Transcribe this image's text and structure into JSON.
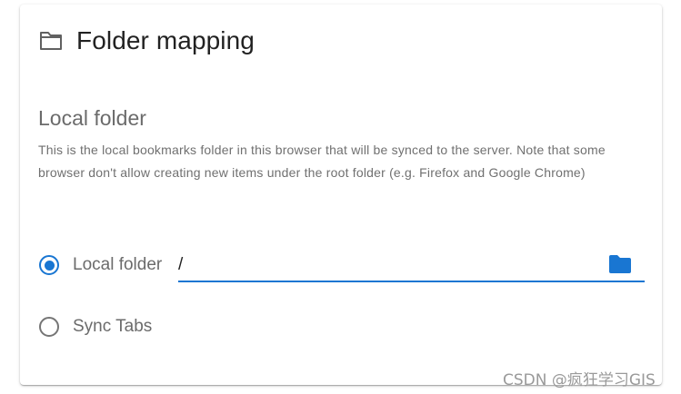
{
  "card": {
    "title": "Folder mapping",
    "title_icon": "folder-outline-icon"
  },
  "section": {
    "title": "Local folder",
    "description": "This is the local bookmarks folder in this browser that will be synced to the server. Note that some browser don't allow creating new items under the root folder (e.g. Firefox and Google Chrome)"
  },
  "options": {
    "local_folder": {
      "label": "Local folder",
      "selected": true,
      "value": "/",
      "picker_icon": "folder-icon"
    },
    "sync_tabs": {
      "label": "Sync Tabs",
      "selected": false
    }
  },
  "watermark": "CSDN @疯狂学习GIS",
  "colors": {
    "accent": "#1976d2",
    "text_primary": "#222222",
    "text_secondary": "#6b6b6b"
  }
}
